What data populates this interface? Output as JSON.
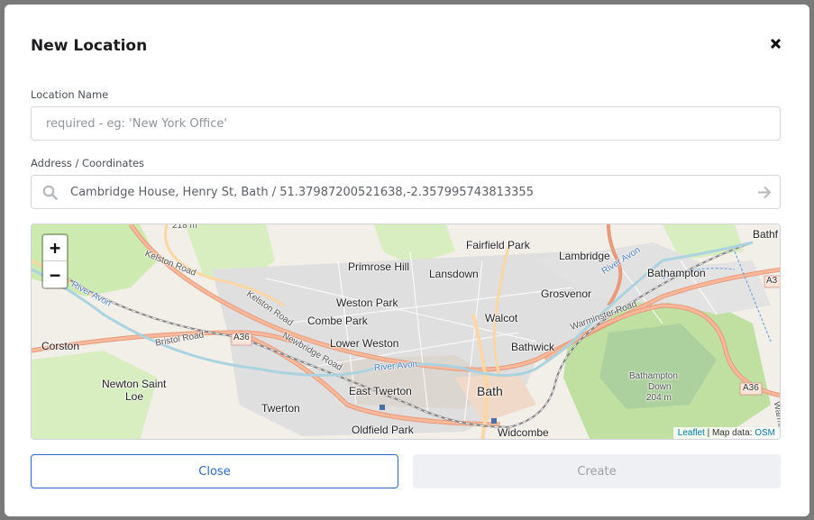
{
  "modal": {
    "title": "New Location"
  },
  "location_name": {
    "label": "Location Name",
    "value": "",
    "placeholder": "required - eg: 'New York Office'"
  },
  "address": {
    "label": "Address / Coordinates",
    "value": "Cambridge House, Henry St, Bath / 51.37987200521638,-2.357995743813355"
  },
  "map": {
    "zoom_in": "+",
    "zoom_out": "−",
    "attribution_leaflet": "Leaflet",
    "attribution_text": "| Map data:",
    "attribution_osm": "OSM",
    "places": {
      "p218m": "218 m",
      "fairfield_park": "Fairfield Park",
      "lambridge": "Lambridge",
      "bathampton": "Bathampton",
      "bathf": "Bathf",
      "primrose_hill": "Primrose Hill",
      "lansdown": "Lansdown",
      "weston_park": "Weston Park",
      "grosvenor": "Grosvenor",
      "combe_park": "Combe Park",
      "walcot": "Walcot",
      "corston": "Corston",
      "lower_weston": "Lower Weston",
      "bathwick": "Bathwick",
      "newton_saint_loe_1": "Newton Saint",
      "newton_saint_loe_2": "Loe",
      "east_twerton": "East Twerton",
      "bath": "Bath",
      "bathampton_down_1": "Bathampton",
      "bathampton_down_2": "Down",
      "bathampton_down_3": "204 m",
      "twerton": "Twerton",
      "oldfield_park": "Oldfield Park",
      "widcombe": "Widcombe",
      "kelston_road_1": "Kelston Road",
      "kelston_road_2": "Kelston Road",
      "bristol_road": "Bristol Road",
      "newbridge_road": "Newbridge Road",
      "river_avon_1": "River Avon",
      "river_avon_2": "River Avon",
      "river_avon_3": "River Avon",
      "warminster_road": "Warminster Road",
      "a36_1": "A36",
      "a36_2": "A36",
      "a3_edge": "A3",
      "warmin_edge": "Warmin"
    }
  },
  "buttons": {
    "close": "Close",
    "create": "Create"
  },
  "colors": {
    "primary": "#2f67c9",
    "disabled_bg": "#eef0f3",
    "disabled_text": "#9aa0a6"
  }
}
